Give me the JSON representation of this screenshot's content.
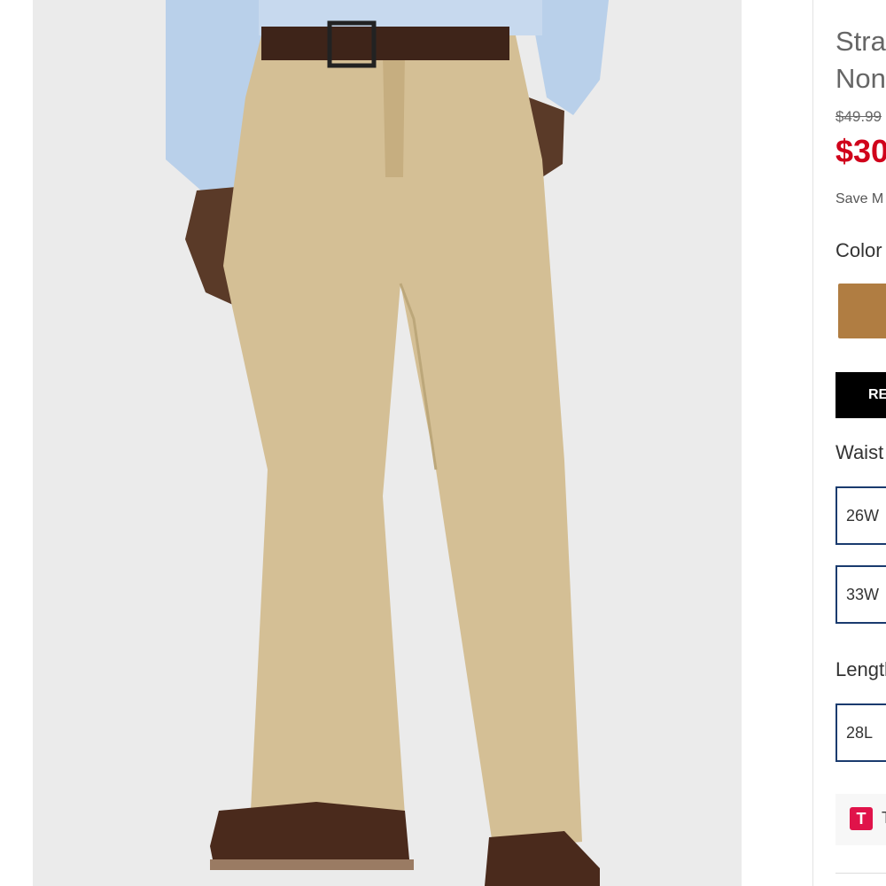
{
  "product": {
    "title_line1": "Straight",
    "title_line2": "Non-Stretch",
    "original_price": "$49.99",
    "sale_price": "$30",
    "save_text": "Save M",
    "image_alt": "Man wearing khaki straight-fit pants with dark brown belt and brown suede shoes"
  },
  "color": {
    "label": "Color",
    "selected_swatch": "#b07d42"
  },
  "fit_button": {
    "label": "RE"
  },
  "waist": {
    "label": "Waist",
    "options": [
      "26W",
      "33W"
    ]
  },
  "length": {
    "label": "Length",
    "options": [
      "28L"
    ]
  },
  "promo": {
    "icon_letter": "T",
    "text": "T"
  },
  "colors": {
    "sale_red": "#d0021b",
    "option_border": "#1a3b6e",
    "promo_pink": "#e0134a"
  }
}
